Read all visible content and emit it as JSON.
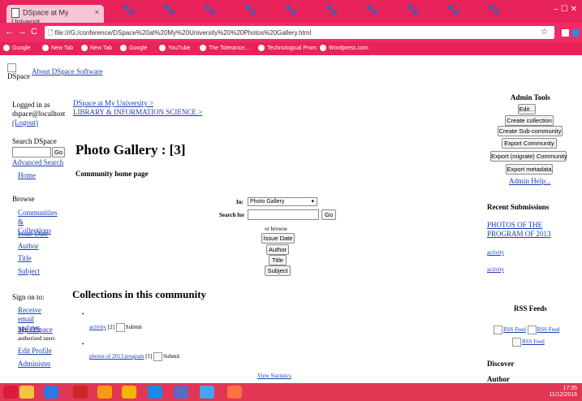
{
  "browser": {
    "tab_title": "DSpace at My Universit",
    "tab_close": "×",
    "window_controls": "‒ ☐ ✕",
    "url": "file:///G:/conference/DSpace%20at%20My%20University%20%20Photos%20Gallery.html",
    "bookmarks": [
      "Google",
      "New Tab",
      "New Tab",
      "Google",
      "YouTube",
      "The Tolerance...",
      "Technological Prom",
      "Wordpress.com"
    ]
  },
  "header": {
    "logo_alt": "DSpace",
    "about_link": "About DSpace Software"
  },
  "left": {
    "logged_in": [
      "Logged in as",
      "dspace@localhost"
    ],
    "logout": "(Logout)",
    "search_label": "Search DSpace",
    "go": "Go",
    "advanced_search": "Advanced Search",
    "home": "Home",
    "browse_label": "Browse",
    "browse_links": [
      "Communities & Collections",
      "Issue Date",
      "Author",
      "Title",
      "Subject"
    ],
    "sign_on_label": "Sign on to:",
    "receive_email": "Receive email updates",
    "my_dspace": "My DSpace",
    "authorized_users": "authorized users",
    "edit_profile": "Edit Profile",
    "administer": "Administer"
  },
  "main": {
    "breadcrumb_1": "DSpace at My University >",
    "breadcrumb_2": "LIBRARY & INFORMATION SCIENCE >",
    "title": "Photo Gallery : [3]",
    "community_home": "Community home page",
    "in_label": "In:",
    "in_value": "Photo Gallery",
    "search_for_label": "Search for",
    "go": "Go",
    "or_browse": "or browse",
    "browse_buttons": [
      "Issue Date",
      "Author",
      "Title",
      "Subject"
    ],
    "collections_heading": "Collections in this community",
    "collections": [
      {
        "name": "activity",
        "count": "[2]",
        "submit": "Submit"
      },
      {
        "name": "photos of 2013 program",
        "count": "[1]",
        "submit": "Submit"
      }
    ],
    "view_statistics": "View Statistics"
  },
  "right": {
    "admin_tools": "Admin Tools",
    "admin_buttons": [
      "Edit...",
      "Create collection",
      "Create Sub-community",
      "Export Community",
      "Export (migrate) Community",
      "Export metadata"
    ],
    "admin_help": "Admin Help...",
    "recent_submissions": "Recent Submissions",
    "recent_items": [
      "PHOTOS OF THE PROGRAM OF 2013",
      "activity",
      "activity"
    ],
    "rss_feeds": "RSS Feeds",
    "rss_items": [
      "RSS Feed",
      "RSS Feed",
      "RSS Feed"
    ],
    "discover": "Discover",
    "author": "Author"
  },
  "taskbar": {
    "clock": "17:35",
    "date": "11/12/2016"
  },
  "colors": {
    "chrome_pink": "#e8225a",
    "link_blue": "#1a3db2",
    "taskbar": "#e13654"
  }
}
